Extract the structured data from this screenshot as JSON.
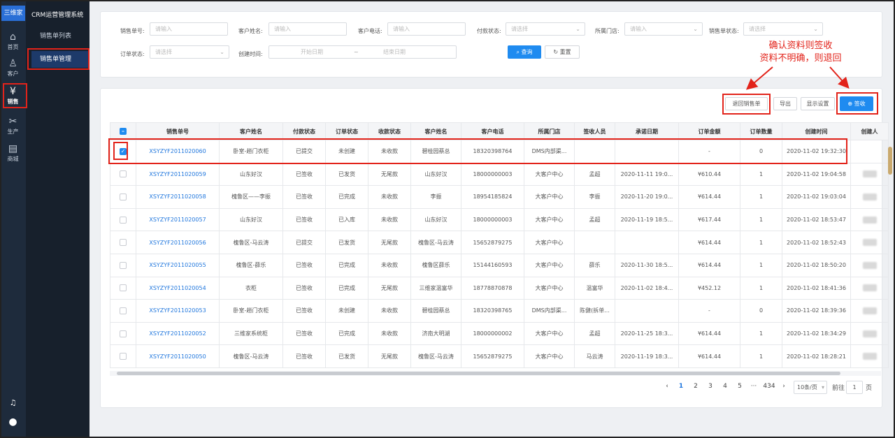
{
  "app": {
    "logo": "三维家",
    "system_title": "CRM运营管理系统"
  },
  "rail": [
    {
      "label": "首页",
      "icon": "home-icon",
      "glyph": "⌂"
    },
    {
      "label": "客户",
      "icon": "user-icon",
      "glyph": "♙"
    },
    {
      "label": "销售",
      "icon": "yen-icon",
      "glyph": "¥"
    },
    {
      "label": "生产",
      "icon": "tools-icon",
      "glyph": "✂"
    },
    {
      "label": "商城",
      "icon": "document-icon",
      "glyph": "▤"
    }
  ],
  "rail_bottom": {
    "bell": "♫",
    "avatar": "●"
  },
  "submenu": [
    "销售单列表",
    "销售单管理"
  ],
  "filters": {
    "order_no": {
      "label": "销售单号:",
      "placeholder": "请输入"
    },
    "customer_name": {
      "label": "客户姓名:",
      "placeholder": "请输入"
    },
    "customer_phone": {
      "label": "客户电话:",
      "placeholder": "请输入"
    },
    "pay_status": {
      "label": "付款状态:",
      "placeholder": "请选择"
    },
    "store": {
      "label": "所属门店:",
      "placeholder": "请输入"
    },
    "order_status_top": {
      "label": "销售单状态:",
      "placeholder": "请选择"
    },
    "order_state": {
      "label": "订单状态:",
      "placeholder": "请选择"
    },
    "created": {
      "label": "创建时间:",
      "start": "开始日期",
      "sep": "~",
      "end": "结束日期"
    },
    "query_button": "查询",
    "reset_button": "重置"
  },
  "annotation": {
    "line1": "确认资料则签收",
    "line2": "资料不明确，则退回"
  },
  "toolbar": {
    "return": "退回销售单",
    "export": "导出",
    "display": "显示设置",
    "sign": "签收"
  },
  "table": {
    "headers": [
      "销售单号",
      "客户姓名",
      "付款状态",
      "订单状态",
      "收款状态",
      "客户姓名",
      "客户电话",
      "所属门店",
      "签收人员",
      "承诺日期",
      "订单金额",
      "订单数量",
      "创建时间",
      "创建人"
    ],
    "rows": [
      {
        "checked": true,
        "no": "XSYZYF2011020060",
        "name": "卧室-趟门衣柜",
        "pay": "已提交",
        "order": "未创建",
        "collect": "未收款",
        "customer": "碧桂园蔡总",
        "phone": "18320398764",
        "store": "DMS内部渠...",
        "signer": "",
        "promise": "",
        "amount": "-",
        "qty": "0",
        "created": "2020-11-02 19:32:30",
        "creator": ""
      },
      {
        "checked": false,
        "no": "XSYZYF2011020059",
        "name": "山东好汉",
        "pay": "已签收",
        "order": "已发货",
        "collect": "无尾款",
        "customer": "山东好汉",
        "phone": "18000000003",
        "store": "大客户中心",
        "signer": "孟超",
        "promise": "2020-11-11 19:0...",
        "amount": "¥610.44",
        "qty": "1",
        "created": "2020-11-02 19:04:58",
        "creator": ""
      },
      {
        "checked": false,
        "no": "XSYZYF2011020058",
        "name": "槐鲁区——李振",
        "pay": "已签收",
        "order": "已完成",
        "collect": "未收款",
        "customer": "李振",
        "phone": "18954185824",
        "store": "大客户中心",
        "signer": "李振",
        "promise": "2020-11-20 19:0...",
        "amount": "¥614.44",
        "qty": "1",
        "created": "2020-11-02 19:03:04",
        "creator": ""
      },
      {
        "checked": false,
        "no": "XSYZYF2011020057",
        "name": "山东好汉",
        "pay": "已签收",
        "order": "已入库",
        "collect": "未收款",
        "customer": "山东好汉",
        "phone": "18000000003",
        "store": "大客户中心",
        "signer": "孟超",
        "promise": "2020-11-19 18:5...",
        "amount": "¥617.44",
        "qty": "1",
        "created": "2020-11-02 18:53:47",
        "creator": ""
      },
      {
        "checked": false,
        "no": "XSYZYF2011020056",
        "name": "槐鲁区-马云涛",
        "pay": "已提交",
        "order": "已发货",
        "collect": "无尾款",
        "customer": "槐鲁区-马云涛",
        "phone": "15652879275",
        "store": "大客户中心",
        "signer": "",
        "promise": "",
        "amount": "¥614.44",
        "qty": "1",
        "created": "2020-11-02 18:52:43",
        "creator": ""
      },
      {
        "checked": false,
        "no": "XSYZYF2011020055",
        "name": "槐鲁区-薛乐",
        "pay": "已签收",
        "order": "已完成",
        "collect": "未收款",
        "customer": "槐鲁区薛乐",
        "phone": "15144160593",
        "store": "大客户中心",
        "signer": "薛乐",
        "promise": "2020-11-30 18:5...",
        "amount": "¥614.44",
        "qty": "1",
        "created": "2020-11-02 18:50:20",
        "creator": ""
      },
      {
        "checked": false,
        "no": "XSYZYF2011020054",
        "name": "衣柜",
        "pay": "已签收",
        "order": "已完成",
        "collect": "无尾款",
        "customer": "三维家温富华",
        "phone": "18778870878",
        "store": "大客户中心",
        "signer": "温富华",
        "promise": "2020-11-02 18:4...",
        "amount": "¥452.12",
        "qty": "1",
        "created": "2020-11-02 18:41:36",
        "creator": ""
      },
      {
        "checked": false,
        "no": "XSYZYF2011020053",
        "name": "卧室-趟门衣柜",
        "pay": "已签收",
        "order": "未创建",
        "collect": "未收款",
        "customer": "碧桂园蔡总",
        "phone": "18320398765",
        "store": "DMS内部渠...",
        "signer": "陈健(拆单...",
        "promise": "",
        "amount": "-",
        "qty": "0",
        "created": "2020-11-02 18:39:36",
        "creator": ""
      },
      {
        "checked": false,
        "no": "XSYZYF2011020052",
        "name": "三维家系统柜",
        "pay": "已签收",
        "order": "已完成",
        "collect": "未收款",
        "customer": "济南大明湖",
        "phone": "18000000002",
        "store": "大客户中心",
        "signer": "孟超",
        "promise": "2020-11-25 18:3...",
        "amount": "¥614.44",
        "qty": "1",
        "created": "2020-11-02 18:34:29",
        "creator": ""
      },
      {
        "checked": false,
        "no": "XSYZYF2011020050",
        "name": "槐鲁区-马云涛",
        "pay": "已签收",
        "order": "已发货",
        "collect": "无尾款",
        "customer": "槐鲁区-马云涛",
        "phone": "15652879275",
        "store": "大客户中心",
        "signer": "马云涛",
        "promise": "2020-11-19 18:3...",
        "amount": "¥614.44",
        "qty": "1",
        "created": "2020-11-02 18:28:21",
        "creator": ""
      }
    ]
  },
  "pagination": {
    "prev": "‹",
    "next": "›",
    "pages": [
      "1",
      "2",
      "3",
      "4",
      "5",
      "···",
      "434"
    ],
    "active": "1",
    "page_size": "10条/页",
    "goto_label": "前往",
    "goto_value": "1",
    "page_suffix": "页"
  }
}
